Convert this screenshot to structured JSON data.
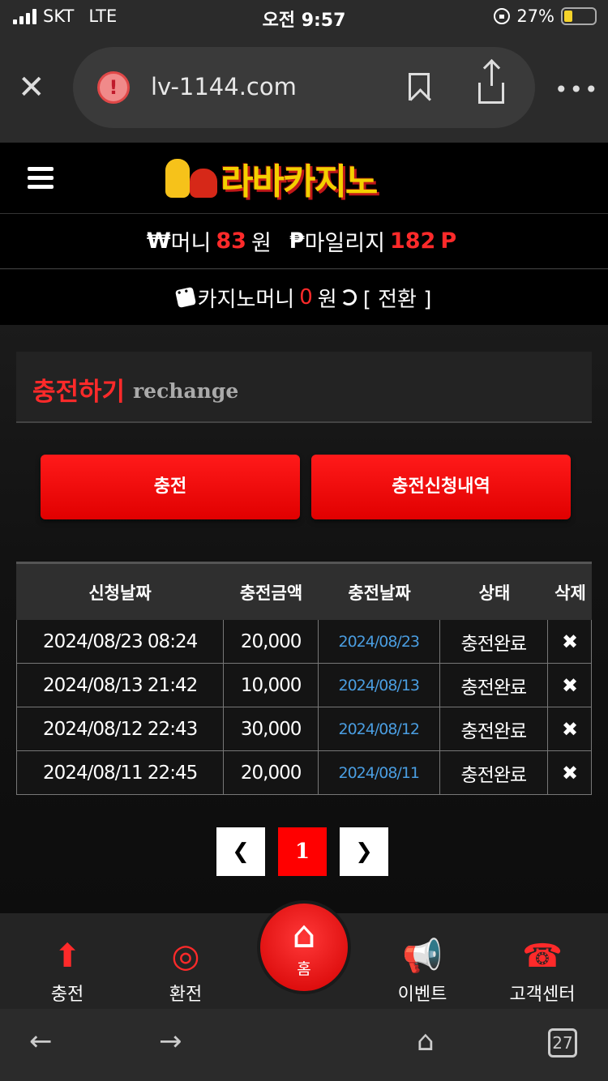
{
  "status_bar": {
    "carrier": "SKT",
    "network": "LTE",
    "time": "오전 9:57",
    "battery": "27%"
  },
  "browser": {
    "url": "lv-1144.com",
    "close_icon": "close-icon",
    "more_label": "•••"
  },
  "site": {
    "logo_text": "라바카지노"
  },
  "wallet": {
    "money_symbol": "₩",
    "money_label": "머니",
    "money_value": "83",
    "money_unit": "원",
    "mileage_symbol": "₱",
    "mileage_label": "마일리지",
    "mileage_value": "182",
    "mileage_unit": "P",
    "casino_label": "카지노머니",
    "casino_value": "0",
    "casino_unit": "원",
    "convert_label": "[ 전환 ]"
  },
  "page": {
    "title_ko": "충전하기",
    "title_en": "rechange"
  },
  "buttons": {
    "charge": "충전",
    "history": "충전신청내역"
  },
  "table": {
    "headers": [
      "신청날짜",
      "충전금액",
      "충전날짜",
      "상태",
      "삭제"
    ],
    "rows": [
      [
        "2024/08/23 08:24",
        "20,000",
        "2024/08/23",
        "충전완료",
        "✖"
      ],
      [
        "2024/08/13 21:42",
        "10,000",
        "2024/08/13",
        "충전완료",
        "✖"
      ],
      [
        "2024/08/12 22:43",
        "30,000",
        "2024/08/12",
        "충전완료",
        "✖"
      ],
      [
        "2024/08/11 22:45",
        "20,000",
        "2024/08/11",
        "충전완료",
        "✖"
      ]
    ]
  },
  "pager": {
    "prev": "❮",
    "current": "1",
    "next": "❯"
  },
  "bottom_nav": {
    "charge": "충전",
    "exchange": "환전",
    "home": "홈",
    "event": "이벤트",
    "support": "고객센터"
  },
  "safari": {
    "back": "←",
    "forward": "→",
    "tab_count": "27"
  },
  "colors": {
    "accent": "#ff2a2a",
    "background": "#111111",
    "link": "#4a9de0"
  }
}
